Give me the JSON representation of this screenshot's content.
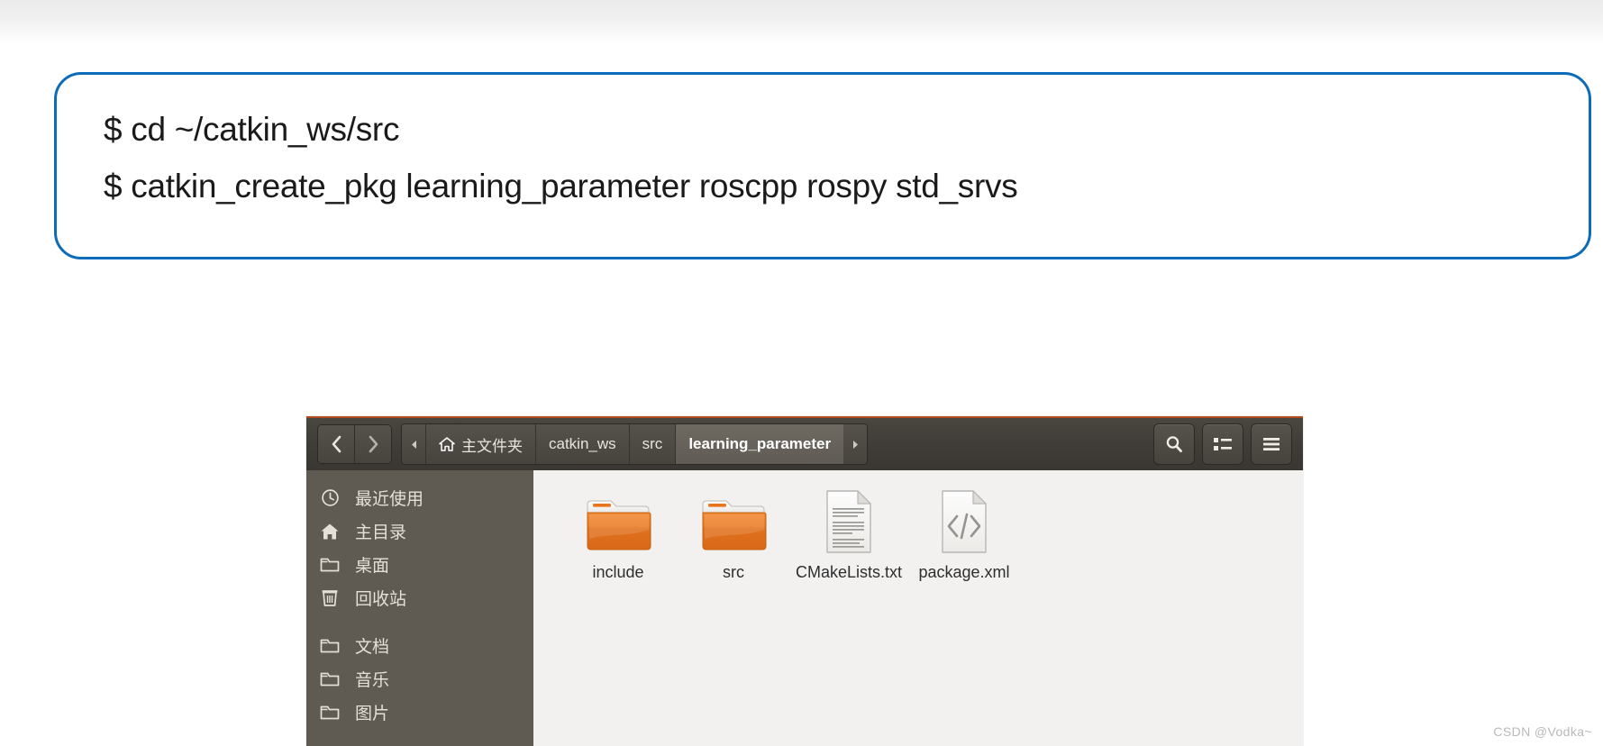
{
  "command_box": {
    "border_color": "#0d6cb9",
    "lines": [
      "$ cd ~/catkin_ws/src",
      "$ catkin_create_pkg learning_parameter roscpp rospy std_srvs"
    ]
  },
  "file_manager": {
    "toolbar": {
      "back_label": "‹",
      "forward_label": "›",
      "crumb_prev_label": "◂",
      "crumb_next_label": "▸",
      "breadcrumbs": [
        {
          "label": "主文件夹",
          "icon": "home-icon",
          "active": false
        },
        {
          "label": "catkin_ws",
          "icon": "",
          "active": false
        },
        {
          "label": "src",
          "icon": "",
          "active": false
        },
        {
          "label": "learning_parameter",
          "icon": "",
          "active": true
        }
      ],
      "buttons": [
        {
          "name": "search-icon",
          "label": "搜索"
        },
        {
          "name": "view-list-icon",
          "label": "视图"
        },
        {
          "name": "hamburger-menu-icon",
          "label": "菜单"
        }
      ]
    },
    "sidebar": {
      "items": [
        {
          "label": "最近使用",
          "icon": "clock-icon"
        },
        {
          "label": "主目录",
          "icon": "home-icon"
        },
        {
          "label": "桌面",
          "icon": "folder-icon"
        },
        {
          "label": "回收站",
          "icon": "trash-icon"
        },
        {
          "label": "文档",
          "icon": "folder-icon",
          "gap_before": true
        },
        {
          "label": "音乐",
          "icon": "folder-icon"
        },
        {
          "label": "图片",
          "icon": "folder-icon"
        }
      ]
    },
    "files": [
      {
        "label": "include",
        "type": "folder"
      },
      {
        "label": "src",
        "type": "folder"
      },
      {
        "label": "CMakeLists.txt",
        "type": "text-document"
      },
      {
        "label": "package.xml",
        "type": "code-document"
      }
    ],
    "colors": {
      "folder": "#e8741d",
      "toolbar": "#3f3c37",
      "sidebar": "#5f5b53",
      "accent_top": "#b24b1c"
    }
  },
  "watermark": {
    "text": "CSDN @Vodka~"
  }
}
